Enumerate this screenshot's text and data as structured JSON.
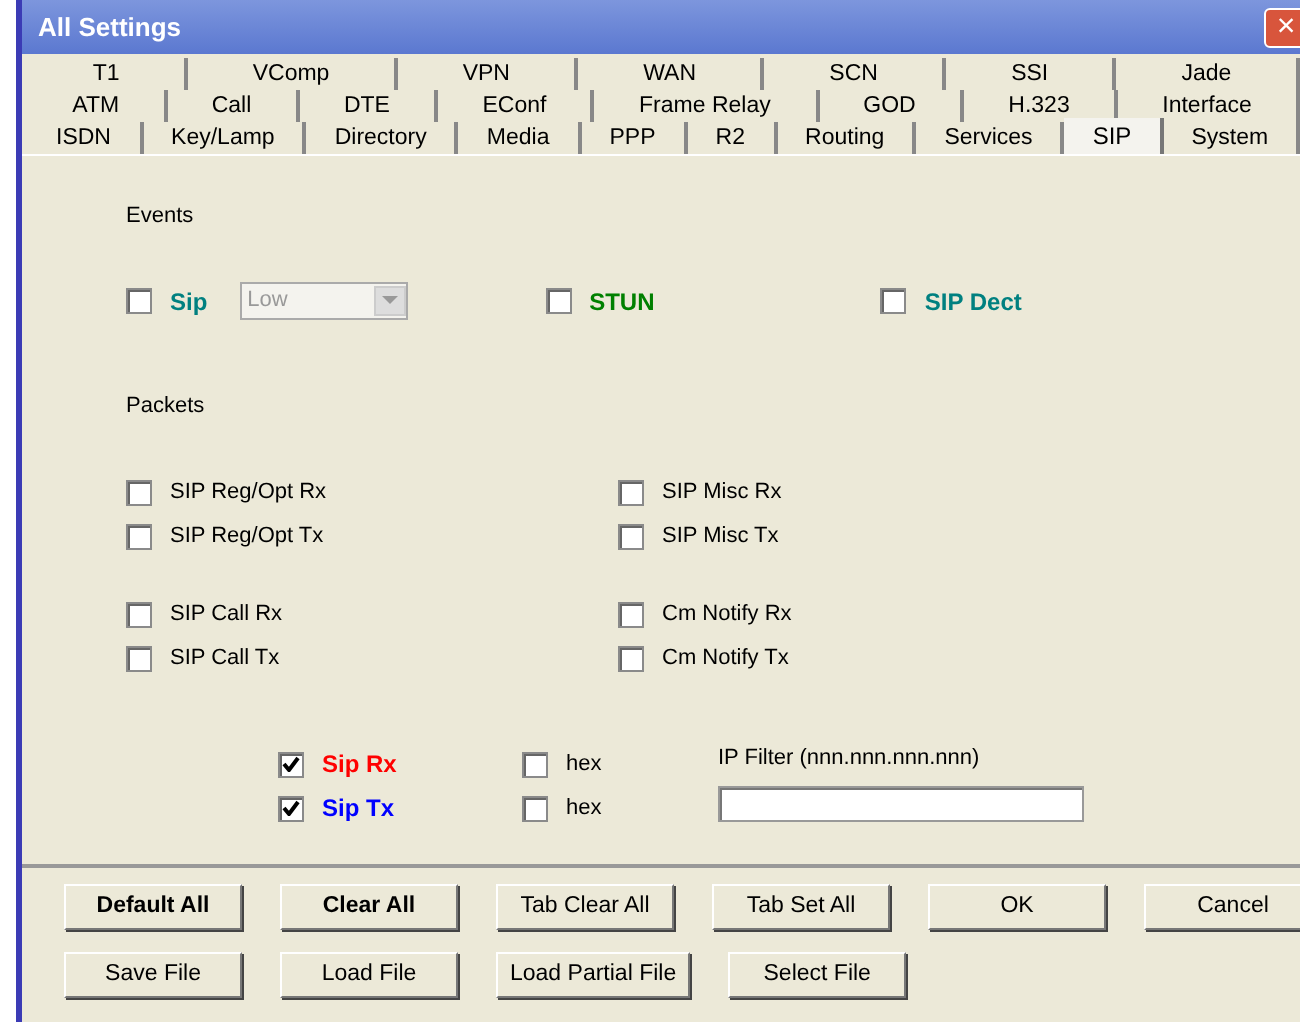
{
  "window": {
    "title": "All Settings",
    "close": "×"
  },
  "tab_rows": [
    [
      {
        "label": "T1",
        "selected": false
      },
      {
        "label": "VComp",
        "selected": false
      },
      {
        "label": "VPN",
        "selected": false
      },
      {
        "label": "WAN",
        "selected": false
      },
      {
        "label": "SCN",
        "selected": false
      },
      {
        "label": "SSI",
        "selected": false
      },
      {
        "label": "Jade",
        "selected": false
      }
    ],
    [
      {
        "label": "ATM",
        "selected": false
      },
      {
        "label": "Call",
        "selected": false
      },
      {
        "label": "DTE",
        "selected": false
      },
      {
        "label": "EConf",
        "selected": false
      },
      {
        "label": "Frame Relay",
        "selected": false
      },
      {
        "label": "GOD",
        "selected": false
      },
      {
        "label": "H.323",
        "selected": false
      },
      {
        "label": "Interface",
        "selected": false
      }
    ],
    [
      {
        "label": "ISDN",
        "selected": false
      },
      {
        "label": "Key/Lamp",
        "selected": false
      },
      {
        "label": "Directory",
        "selected": false
      },
      {
        "label": "Media",
        "selected": false
      },
      {
        "label": "PPP",
        "selected": false
      },
      {
        "label": "R2",
        "selected": false
      },
      {
        "label": "Routing",
        "selected": false
      },
      {
        "label": "Services",
        "selected": false
      },
      {
        "label": "SIP",
        "selected": true
      },
      {
        "label": "System",
        "selected": false
      }
    ]
  ],
  "events": {
    "heading": "Events",
    "items": [
      {
        "label": "Sip",
        "checked": false,
        "color": "#008080",
        "dropdown": {
          "value": "Low",
          "disabled": true
        }
      },
      {
        "label": "STUN",
        "checked": false,
        "color": "#008000"
      },
      {
        "label": "SIP Dect",
        "checked": false,
        "color": "#008080"
      }
    ]
  },
  "packets": {
    "heading": "Packets",
    "groups": [
      [
        [
          {
            "label": "SIP Reg/Opt Rx",
            "checked": false
          },
          {
            "label": "SIP Misc Rx",
            "checked": false
          }
        ],
        [
          {
            "label": "SIP Reg/Opt Tx",
            "checked": false
          },
          {
            "label": "SIP Misc Tx",
            "checked": false
          }
        ]
      ],
      [
        [
          {
            "label": "SIP Call Rx",
            "checked": false
          },
          {
            "label": "Cm Notify Rx",
            "checked": false
          }
        ],
        [
          {
            "label": "SIP Call Tx",
            "checked": false
          },
          {
            "label": "Cm Notify Tx",
            "checked": false
          }
        ]
      ]
    ]
  },
  "trace": {
    "rows": [
      {
        "label": "Sip Rx",
        "checked": true,
        "color": "#ff0000",
        "hex": {
          "label": "hex",
          "checked": false
        }
      },
      {
        "label": "Sip Tx",
        "checked": true,
        "color": "#0000ff",
        "hex": {
          "label": "hex",
          "checked": false
        }
      }
    ],
    "ip_filter": {
      "label": "IP Filter (nnn.nnn.nnn.nnn)"
    }
  },
  "button_rows": [
    [
      {
        "label": "Default All",
        "bold": true
      },
      {
        "label": "Clear All",
        "bold": true
      },
      {
        "label": "Tab Clear All",
        "bold": false
      },
      {
        "label": "Tab Set All",
        "bold": false
      },
      {
        "label": "OK",
        "bold": false
      },
      {
        "label": "Cancel",
        "bold": false
      }
    ],
    [
      {
        "label": "Save File",
        "bold": false
      },
      {
        "label": "Load File",
        "bold": false
      },
      {
        "label": "Load Partial File",
        "bold": false
      },
      {
        "label": "Select File",
        "bold": false
      }
    ]
  ]
}
